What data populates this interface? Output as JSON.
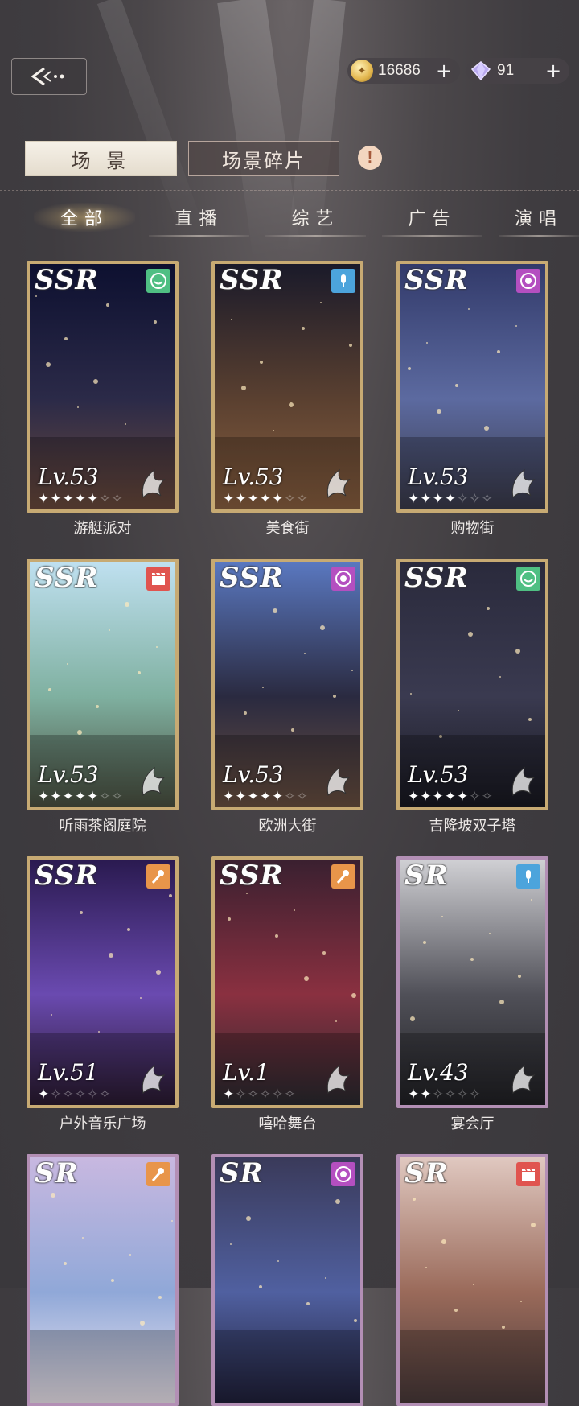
{
  "currencies": [
    {
      "name": "gold",
      "value": "16686",
      "icon": "coin-icon",
      "color": "#e8c46a"
    },
    {
      "name": "diamond",
      "value": "91",
      "icon": "diamond-icon",
      "color": "#b9a9f0"
    }
  ],
  "segments": {
    "scene": "场 景",
    "fragments": "场景碎片"
  },
  "tabs": [
    "全部",
    "直播",
    "综艺",
    "广告",
    "演唱"
  ],
  "cards": [
    {
      "name": "游艇派对",
      "rarity": "SSR",
      "level": "Lv.53",
      "stars_filled": 5,
      "stars_total": 7,
      "type": "variety",
      "badge_color": "#4fbf83",
      "scene": [
        "#0d1030",
        "#2b2a48",
        "#6b4a3c"
      ]
    },
    {
      "name": "美食街",
      "rarity": "SSR",
      "level": "Lv.53",
      "stars_filled": 5,
      "stars_total": 7,
      "type": "live",
      "badge_color": "#4ca4dc",
      "scene": [
        "#1a1a2a",
        "#5a4030",
        "#8a6040"
      ]
    },
    {
      "name": "购物街",
      "rarity": "SSR",
      "level": "Lv.53",
      "stars_filled": 4,
      "stars_total": 7,
      "type": "concert",
      "badge_color": "#b44fc0",
      "scene": [
        "#323a6a",
        "#5c6aa0",
        "#3a3a4a"
      ]
    },
    {
      "name": "听雨茶阁庭院",
      "rarity": "SSR",
      "level": "Lv.53",
      "stars_filled": 5,
      "stars_total": 7,
      "type": "ad",
      "badge_color": "#e0544f",
      "scene": [
        "#bfe0f0",
        "#7fb0a0",
        "#4a5040"
      ]
    },
    {
      "name": "欧洲大街",
      "rarity": "SSR",
      "level": "Lv.53",
      "stars_filled": 5,
      "stars_total": 7,
      "type": "concert",
      "badge_color": "#b44fc0",
      "scene": [
        "#5a78c0",
        "#2a2a40",
        "#6a5040"
      ]
    },
    {
      "name": "吉隆坡双子塔",
      "rarity": "SSR",
      "level": "Lv.53",
      "stars_filled": 5,
      "stars_total": 7,
      "type": "variety",
      "badge_color": "#4fbf83",
      "scene": [
        "#2a2a3c",
        "#3a3a50",
        "#181820"
      ]
    },
    {
      "name": "户外音乐广场",
      "rarity": "SSR",
      "level": "Lv.51",
      "stars_filled": 1,
      "stars_total": 6,
      "type": "show",
      "badge_color": "#e8954a",
      "scene": [
        "#2a1a50",
        "#6a4ab0",
        "#2a1a30"
      ]
    },
    {
      "name": "嘻哈舞台",
      "rarity": "SSR",
      "level": "Lv.1",
      "stars_filled": 1,
      "stars_total": 6,
      "type": "show",
      "badge_color": "#e8954a",
      "scene": [
        "#3a2030",
        "#8a3040",
        "#2a2a30"
      ]
    },
    {
      "name": "宴会厅",
      "rarity": "SR",
      "level": "Lv.43",
      "stars_filled": 2,
      "stars_total": 6,
      "type": "live",
      "badge_color": "#4ca4dc",
      "scene": [
        "#d0d0d4",
        "#505058",
        "#202024"
      ]
    },
    {
      "name": "",
      "rarity": "SR",
      "level": "",
      "stars_filled": 0,
      "stars_total": 0,
      "type": "show",
      "badge_color": "#e8954a",
      "scene": [
        "#c8b8e0",
        "#90a8d8",
        "#f0e8f0"
      ]
    },
    {
      "name": "",
      "rarity": "SR",
      "level": "",
      "stars_filled": 0,
      "stars_total": 0,
      "type": "concert",
      "badge_color": "#b44fc0",
      "scene": [
        "#3a3a5a",
        "#5060a0",
        "#20203a"
      ]
    },
    {
      "name": "",
      "rarity": "SR",
      "level": "",
      "stars_filled": 0,
      "stars_total": 0,
      "type": "ad",
      "badge_color": "#e0544f",
      "scene": [
        "#e0c8c0",
        "#9a6a5a",
        "#4a3a3a"
      ]
    }
  ]
}
